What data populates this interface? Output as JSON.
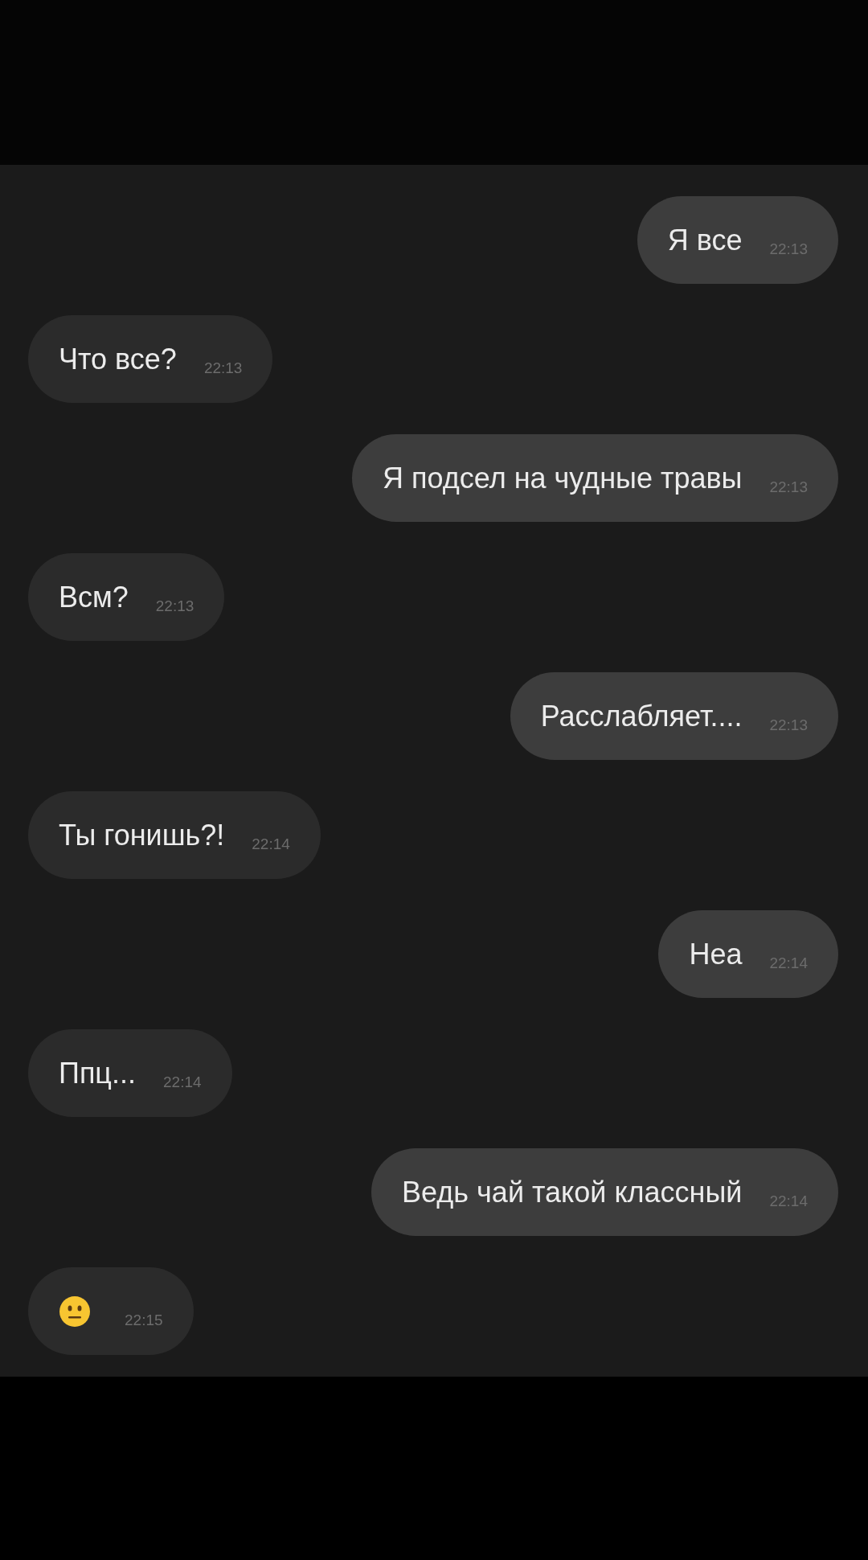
{
  "messages": [
    {
      "kind": "text",
      "outgoing": true,
      "text": "Я все",
      "time": "22:13"
    },
    {
      "kind": "text",
      "outgoing": false,
      "text": "Что все?",
      "time": "22:13"
    },
    {
      "kind": "text",
      "outgoing": true,
      "text": "Я подсел на чудные травы",
      "time": "22:13"
    },
    {
      "kind": "text",
      "outgoing": false,
      "text": "Всм?",
      "time": "22:13"
    },
    {
      "kind": "text",
      "outgoing": true,
      "text": "Расслабляет....",
      "time": "22:13"
    },
    {
      "kind": "text",
      "outgoing": false,
      "text": "Ты гонишь?!",
      "time": "22:14"
    },
    {
      "kind": "text",
      "outgoing": true,
      "text": "Неа",
      "time": "22:14"
    },
    {
      "kind": "text",
      "outgoing": false,
      "text": "Ппц...",
      "time": "22:14"
    },
    {
      "kind": "text",
      "outgoing": true,
      "text": "Ведь чай такой классный",
      "time": "22:14"
    },
    {
      "kind": "emoji",
      "outgoing": false,
      "time": "22:15"
    }
  ]
}
